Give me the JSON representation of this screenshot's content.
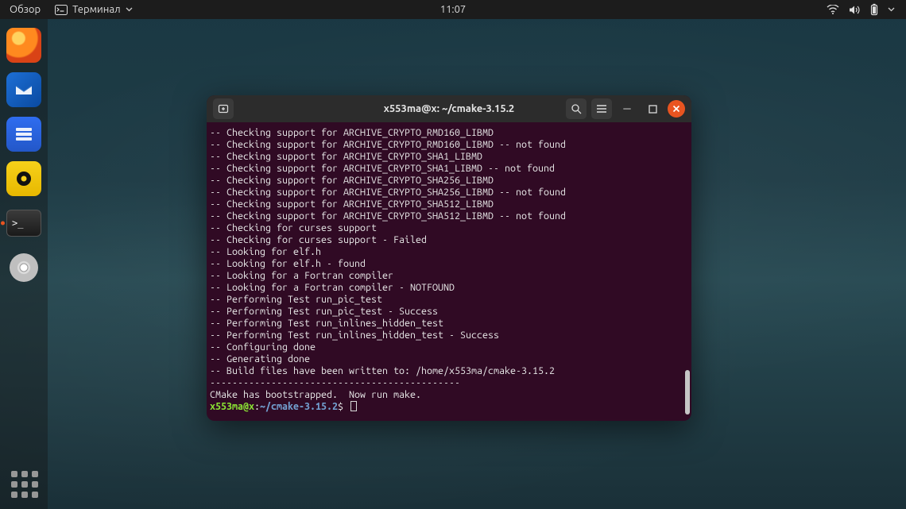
{
  "topbar": {
    "activities": "Обзор",
    "app_label": "Терминал",
    "clock": "11:07"
  },
  "dock": {
    "items": [
      {
        "name": "firefox"
      },
      {
        "name": "thunderbird"
      },
      {
        "name": "files"
      },
      {
        "name": "rhythmbox"
      },
      {
        "name": "terminal"
      },
      {
        "name": "disk"
      }
    ]
  },
  "terminal": {
    "title": "x553ma@x: ~/cmake-3.15.2",
    "prompt": {
      "user_host": "x553ma@x",
      "path": "~/cmake-3.15.2",
      "sigil": "$"
    },
    "lines": [
      "-- Checking support for ARCHIVE_CRYPTO_RMD160_LIBMD",
      "-- Checking support for ARCHIVE_CRYPTO_RMD160_LIBMD -- not found",
      "-- Checking support for ARCHIVE_CRYPTO_SHA1_LIBMD",
      "-- Checking support for ARCHIVE_CRYPTO_SHA1_LIBMD -- not found",
      "-- Checking support for ARCHIVE_CRYPTO_SHA256_LIBMD",
      "-- Checking support for ARCHIVE_CRYPTO_SHA256_LIBMD -- not found",
      "-- Checking support for ARCHIVE_CRYPTO_SHA512_LIBMD",
      "-- Checking support for ARCHIVE_CRYPTO_SHA512_LIBMD -- not found",
      "-- Checking for curses support",
      "-- Checking for curses support - Failed",
      "-- Looking for elf.h",
      "-- Looking for elf.h - found",
      "-- Looking for a Fortran compiler",
      "-- Looking for a Fortran compiler - NOTFOUND",
      "-- Performing Test run_pic_test",
      "-- Performing Test run_pic_test - Success",
      "-- Performing Test run_inlines_hidden_test",
      "-- Performing Test run_inlines_hidden_test - Success",
      "-- Configuring done",
      "-- Generating done",
      "-- Build files have been written to: /home/x553ma/cmake-3.15.2",
      "---------------------------------------------",
      "CMake has bootstrapped.  Now run make."
    ]
  }
}
